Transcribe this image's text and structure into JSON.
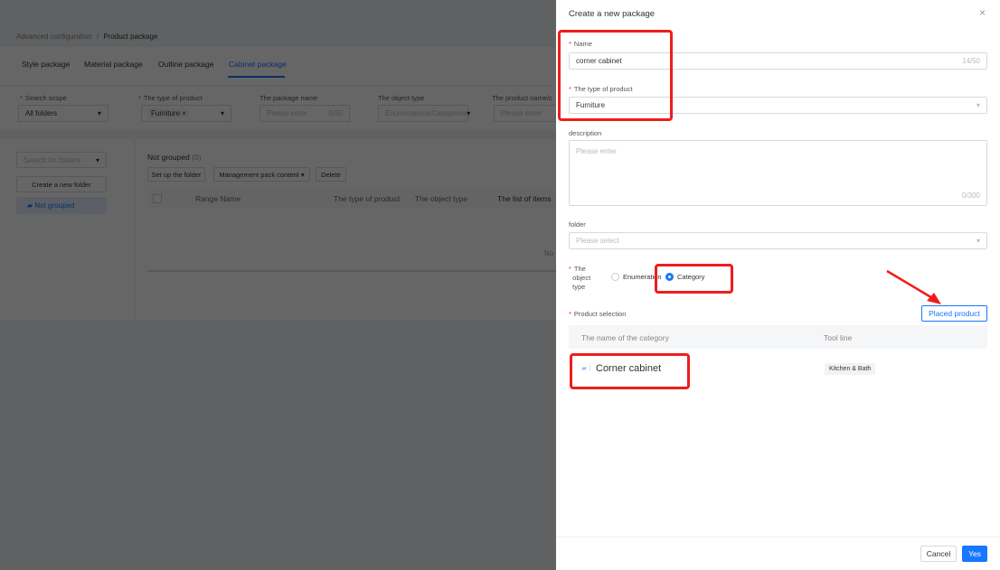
{
  "breadcrumb": {
    "parent": "Advanced configuration",
    "separator": "/",
    "current": "Product package"
  },
  "tabs": [
    {
      "label": "Style package"
    },
    {
      "label": "Material package"
    },
    {
      "label": "Outline package"
    },
    {
      "label": "Cabinet package",
      "active": true
    }
  ],
  "filters": {
    "search_scope": {
      "label": "Search scope",
      "value": "All folders"
    },
    "product_type": {
      "label": "The type of product",
      "tag": "Furniture"
    },
    "package_name": {
      "label": "The package name",
      "placeholder": "Please enter",
      "count": "0/50"
    },
    "object_type": {
      "label": "The object type",
      "placeholder": "Enumerations/Categories"
    },
    "product_name": {
      "label": "The product name/c",
      "placeholder": "Please enter"
    }
  },
  "sidebar": {
    "search_placeholder": "Search for folders",
    "create_folder": "Create a new folder",
    "not_grouped": "Not grouped"
  },
  "main": {
    "title": "Not grouped",
    "count": "(0)",
    "buttons": {
      "setup_folder": "Set up the folder",
      "management": "Management pack content",
      "delete": "Delete"
    },
    "columns": [
      "Range Name",
      "The type of product",
      "The object type",
      "The list of items"
    ],
    "empty": "No"
  },
  "drawer": {
    "title": "Create a new package",
    "name": {
      "label": "Name",
      "value": "corner cabinet",
      "count": "14/50"
    },
    "product_type": {
      "label": "The type of product",
      "value": "Furniture"
    },
    "description": {
      "label": "description",
      "placeholder": "Please enter",
      "count": "0/300"
    },
    "folder": {
      "label": "folder",
      "placeholder": "Please select"
    },
    "object_type": {
      "label_1": "The",
      "label_2": "object",
      "label_3": "type",
      "options": [
        {
          "label": "Enumeration",
          "selected": false
        },
        {
          "label": "Category",
          "selected": true
        }
      ]
    },
    "product_selection": {
      "label": "Product selection",
      "button": "Placed product"
    },
    "table": {
      "columns": [
        "The name of the category",
        "Tool line"
      ],
      "rows": [
        {
          "name": "Corner cabinet",
          "tool_line": "Kitchen & Bath"
        }
      ]
    },
    "footer": {
      "cancel": "Cancel",
      "yes": "Yes"
    }
  },
  "colors": {
    "primary": "#1677ff",
    "annotation": "#f01c1c"
  }
}
